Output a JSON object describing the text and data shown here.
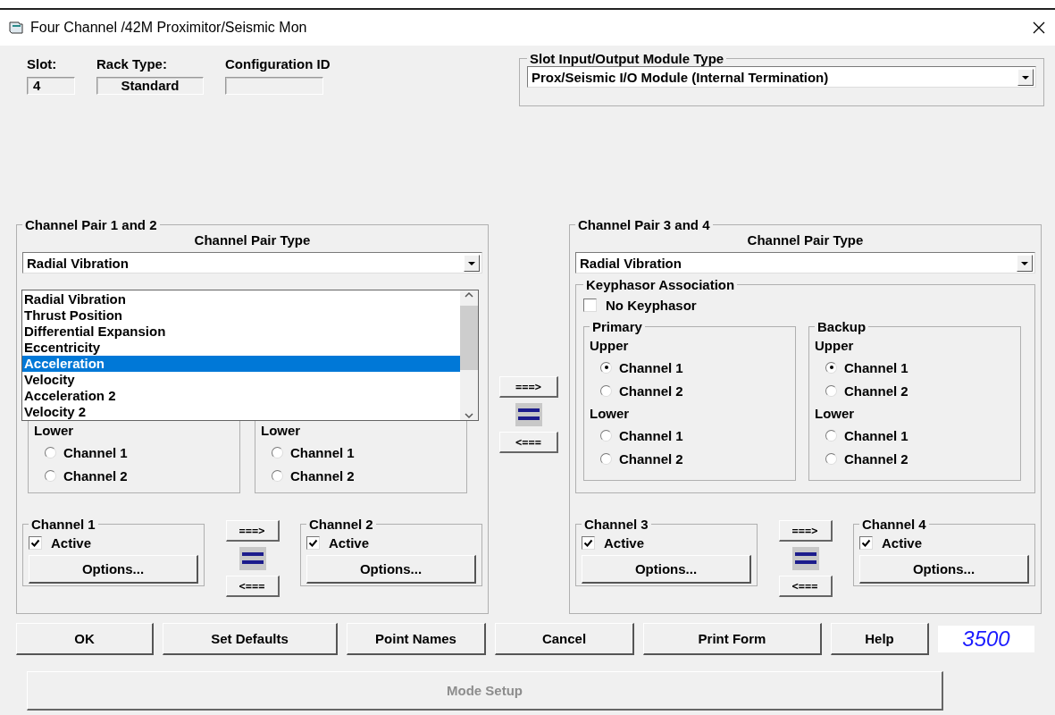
{
  "window": {
    "title": "Four Channel /42M Proximitor/Seismic Mon"
  },
  "info_fields": [
    {
      "label": "Slot:",
      "value": "4"
    },
    {
      "label": "Rack Type:",
      "value": "Standard"
    },
    {
      "label": "Configuration ID"
    }
  ],
  "io_module": {
    "label": "Slot Input/Output Module Type",
    "value": "Prox/Seismic I/O Module (Internal Termination)"
  },
  "pairs": [
    {
      "title": "Channel Pair 1 and 2",
      "type_label": "Channel Pair Type",
      "type_value": "Radial Vibration",
      "dropdown_items": [
        {
          "label": "Radial Vibration",
          "selected": false
        },
        {
          "label": "Thrust Position",
          "selected": false
        },
        {
          "label": "Differential Expansion",
          "selected": false
        },
        {
          "label": "Eccentricity",
          "selected": false
        },
        {
          "label": "Acceleration",
          "selected": true
        },
        {
          "label": "Velocity",
          "selected": false
        },
        {
          "label": "Acceleration 2",
          "selected": false
        },
        {
          "label": "Velocity 2",
          "selected": false
        }
      ],
      "groups": [
        {
          "sections": [
            {
              "label": "Lower",
              "options": [
                {
                  "label": "Channel 1",
                  "selected": false
                },
                {
                  "label": "Channel 2",
                  "selected": false
                }
              ]
            }
          ]
        },
        {
          "sections": [
            {
              "label": "Lower",
              "options": [
                {
                  "label": "Channel 1",
                  "selected": false
                },
                {
                  "label": "Channel 2",
                  "selected": false
                }
              ]
            }
          ]
        }
      ],
      "channels": [
        {
          "title": "Channel 1",
          "active_label": "Active",
          "active": true,
          "options_button": "Options..."
        },
        {
          "title": "Channel 2",
          "active_label": "Active",
          "active": true,
          "options_button": "Options..."
        }
      ],
      "swap": {
        "right": "===>",
        "left": "<==="
      }
    },
    {
      "title": "Channel Pair 3 and 4",
      "type_label": "Channel Pair Type",
      "type_value": "Radial Vibration",
      "association": {
        "title": "Keyphasor Association",
        "no_keyphasor_label": "No Keyphasor",
        "no_keyphasor": false
      },
      "groups": [
        {
          "title": "Primary",
          "sections": [
            {
              "label": "Upper",
              "options": [
                {
                  "label": "Channel 1",
                  "selected": true
                },
                {
                  "label": "Channel 2",
                  "selected": false
                }
              ]
            },
            {
              "label": "Lower",
              "options": [
                {
                  "label": "Channel 1",
                  "selected": false
                },
                {
                  "label": "Channel 2",
                  "selected": false
                }
              ]
            }
          ]
        },
        {
          "title": "Backup",
          "sections": [
            {
              "label": "Upper",
              "options": [
                {
                  "label": "Channel 1",
                  "selected": true
                },
                {
                  "label": "Channel 2",
                  "selected": false
                }
              ]
            },
            {
              "label": "Lower",
              "options": [
                {
                  "label": "Channel 1",
                  "selected": false
                },
                {
                  "label": "Channel 2",
                  "selected": false
                }
              ]
            }
          ]
        }
      ],
      "channels": [
        {
          "title": "Channel 3",
          "active_label": "Active",
          "active": true,
          "options_button": "Options..."
        },
        {
          "title": "Channel 4",
          "active_label": "Active",
          "active": true,
          "options_button": "Options..."
        }
      ],
      "swap": {
        "right": "===>",
        "left": "<==="
      }
    }
  ],
  "pair_swap": {
    "right": "===>",
    "left": "<==="
  },
  "buttons": [
    {
      "label": "OK",
      "disabled": false
    },
    {
      "label": "Set Defaults",
      "disabled": false
    },
    {
      "label": "Point Names",
      "disabled": false
    },
    {
      "label": "Cancel",
      "disabled": false
    },
    {
      "label": "Print Form",
      "disabled": false
    },
    {
      "label": "Help",
      "disabled": false
    }
  ],
  "model_badge": "3500",
  "mode_setup": {
    "label": "Mode Setup",
    "disabled": true
  }
}
